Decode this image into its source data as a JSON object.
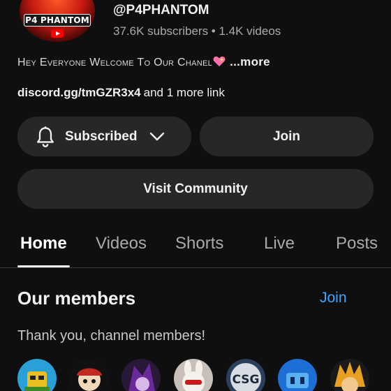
{
  "channel": {
    "handle": "@P4PHANTOM",
    "stats": "37.6K subscribers • 1.4K videos",
    "avatar_text": "P4 PHANTOM",
    "description": "Hey Everyone Welcome To Our Chanel",
    "description_more": "...more",
    "link": "discord.gg/tmGZR3x4",
    "more_links": "and 1 more link"
  },
  "actions": {
    "subscribed_label": "Subscribed",
    "join_label": "Join",
    "community_label": "Visit Community"
  },
  "tabs": [
    {
      "label": "Home",
      "active": true
    },
    {
      "label": "Videos"
    },
    {
      "label": "Shorts"
    },
    {
      "label": "Live"
    },
    {
      "label": "Posts"
    }
  ],
  "members_section": {
    "title": "Our members",
    "join_label": "Join",
    "thanks": "Thank you, channel members!",
    "avatars": [
      {
        "icon": "member-avatar-1",
        "color": "#2aa0d8"
      },
      {
        "icon": "member-avatar-2",
        "color": "#1a1a1a"
      },
      {
        "icon": "member-avatar-3",
        "color": "#5a2a7a"
      },
      {
        "icon": "member-avatar-4",
        "color": "#e8d8d0"
      },
      {
        "icon": "member-avatar-5",
        "color": "#2a3f5a",
        "text": "CSG"
      },
      {
        "icon": "member-avatar-6",
        "color": "#1d6fd6"
      },
      {
        "icon": "member-avatar-7",
        "color": "#c88a20"
      }
    ]
  },
  "colors": {
    "background": "#0f0f0f",
    "button": "#272727",
    "link_blue": "#3ea6ff",
    "muted_text": "#aaaaaa"
  }
}
